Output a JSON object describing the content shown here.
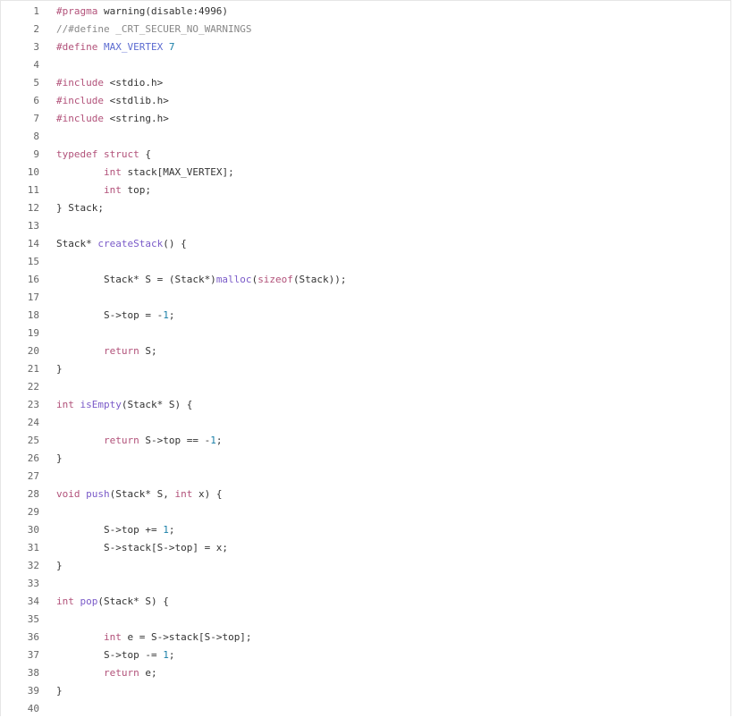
{
  "code_viewer": {
    "language": "c",
    "lines": [
      {
        "num": "1",
        "tokens": [
          {
            "t": "#pragma",
            "k": "pp"
          },
          {
            "t": " warning(disable:4996)",
            "k": "plain"
          }
        ]
      },
      {
        "num": "2",
        "tokens": [
          {
            "t": "//#define _CRT_SECUER_NO_WARNINGS",
            "k": "cm"
          }
        ]
      },
      {
        "num": "3",
        "tokens": [
          {
            "t": "#define",
            "k": "pp"
          },
          {
            "t": " ",
            "k": "plain"
          },
          {
            "t": "MAX_VERTEX",
            "k": "mac"
          },
          {
            "t": " ",
            "k": "plain"
          },
          {
            "t": "7",
            "k": "num"
          }
        ]
      },
      {
        "num": "4",
        "tokens": []
      },
      {
        "num": "5",
        "tokens": [
          {
            "t": "#include",
            "k": "pp"
          },
          {
            "t": " <stdio.h>",
            "k": "str"
          }
        ]
      },
      {
        "num": "6",
        "tokens": [
          {
            "t": "#include",
            "k": "pp"
          },
          {
            "t": " <stdlib.h>",
            "k": "str"
          }
        ]
      },
      {
        "num": "7",
        "tokens": [
          {
            "t": "#include",
            "k": "pp"
          },
          {
            "t": " <string.h>",
            "k": "str"
          }
        ]
      },
      {
        "num": "8",
        "tokens": []
      },
      {
        "num": "9",
        "tokens": [
          {
            "t": "typedef",
            "k": "kw"
          },
          {
            "t": " ",
            "k": "plain"
          },
          {
            "t": "struct",
            "k": "kw"
          },
          {
            "t": " {",
            "k": "plain"
          }
        ]
      },
      {
        "num": "10",
        "tokens": [
          {
            "t": "        ",
            "k": "plain"
          },
          {
            "t": "int",
            "k": "kw"
          },
          {
            "t": " stack[MAX_VERTEX];",
            "k": "plain"
          }
        ]
      },
      {
        "num": "11",
        "tokens": [
          {
            "t": "        ",
            "k": "plain"
          },
          {
            "t": "int",
            "k": "kw"
          },
          {
            "t": " top;",
            "k": "plain"
          }
        ]
      },
      {
        "num": "12",
        "tokens": [
          {
            "t": "} Stack;",
            "k": "plain"
          }
        ]
      },
      {
        "num": "13",
        "tokens": []
      },
      {
        "num": "14",
        "tokens": [
          {
            "t": "Stack* ",
            "k": "plain"
          },
          {
            "t": "createStack",
            "k": "fn"
          },
          {
            "t": "() {",
            "k": "plain"
          }
        ]
      },
      {
        "num": "15",
        "tokens": []
      },
      {
        "num": "16",
        "tokens": [
          {
            "t": "        Stack* S = (Stack*)",
            "k": "plain"
          },
          {
            "t": "malloc",
            "k": "fn"
          },
          {
            "t": "(",
            "k": "plain"
          },
          {
            "t": "sizeof",
            "k": "kw"
          },
          {
            "t": "(Stack));",
            "k": "plain"
          }
        ]
      },
      {
        "num": "17",
        "tokens": []
      },
      {
        "num": "18",
        "tokens": [
          {
            "t": "        S->top = -",
            "k": "plain"
          },
          {
            "t": "1",
            "k": "num"
          },
          {
            "t": ";",
            "k": "plain"
          }
        ]
      },
      {
        "num": "19",
        "tokens": []
      },
      {
        "num": "20",
        "tokens": [
          {
            "t": "        ",
            "k": "plain"
          },
          {
            "t": "return",
            "k": "kw"
          },
          {
            "t": " S;",
            "k": "plain"
          }
        ]
      },
      {
        "num": "21",
        "tokens": [
          {
            "t": "}",
            "k": "plain"
          }
        ]
      },
      {
        "num": "22",
        "tokens": []
      },
      {
        "num": "23",
        "tokens": [
          {
            "t": "int",
            "k": "kw"
          },
          {
            "t": " ",
            "k": "plain"
          },
          {
            "t": "isEmpty",
            "k": "fn"
          },
          {
            "t": "(Stack* S) {",
            "k": "plain"
          }
        ]
      },
      {
        "num": "24",
        "tokens": []
      },
      {
        "num": "25",
        "tokens": [
          {
            "t": "        ",
            "k": "plain"
          },
          {
            "t": "return",
            "k": "kw"
          },
          {
            "t": " S->top == -",
            "k": "plain"
          },
          {
            "t": "1",
            "k": "num"
          },
          {
            "t": ";",
            "k": "plain"
          }
        ]
      },
      {
        "num": "26",
        "tokens": [
          {
            "t": "}",
            "k": "plain"
          }
        ]
      },
      {
        "num": "27",
        "tokens": []
      },
      {
        "num": "28",
        "tokens": [
          {
            "t": "void",
            "k": "kw"
          },
          {
            "t": " ",
            "k": "plain"
          },
          {
            "t": "push",
            "k": "fn"
          },
          {
            "t": "(Stack* S, ",
            "k": "plain"
          },
          {
            "t": "int",
            "k": "kw"
          },
          {
            "t": " x) {",
            "k": "plain"
          }
        ]
      },
      {
        "num": "29",
        "tokens": []
      },
      {
        "num": "30",
        "tokens": [
          {
            "t": "        S->top += ",
            "k": "plain"
          },
          {
            "t": "1",
            "k": "num"
          },
          {
            "t": ";",
            "k": "plain"
          }
        ]
      },
      {
        "num": "31",
        "tokens": [
          {
            "t": "        S->stack[S->top] = x;",
            "k": "plain"
          }
        ]
      },
      {
        "num": "32",
        "tokens": [
          {
            "t": "}",
            "k": "plain"
          }
        ]
      },
      {
        "num": "33",
        "tokens": []
      },
      {
        "num": "34",
        "tokens": [
          {
            "t": "int",
            "k": "kw"
          },
          {
            "t": " ",
            "k": "plain"
          },
          {
            "t": "pop",
            "k": "fn"
          },
          {
            "t": "(Stack* S) {",
            "k": "plain"
          }
        ]
      },
      {
        "num": "35",
        "tokens": []
      },
      {
        "num": "36",
        "tokens": [
          {
            "t": "        ",
            "k": "plain"
          },
          {
            "t": "int",
            "k": "kw"
          },
          {
            "t": " e = S->stack[S->top];",
            "k": "plain"
          }
        ]
      },
      {
        "num": "37",
        "tokens": [
          {
            "t": "        S->top -= ",
            "k": "plain"
          },
          {
            "t": "1",
            "k": "num"
          },
          {
            "t": ";",
            "k": "plain"
          }
        ]
      },
      {
        "num": "38",
        "tokens": [
          {
            "t": "        ",
            "k": "plain"
          },
          {
            "t": "return",
            "k": "kw"
          },
          {
            "t": " e;",
            "k": "plain"
          }
        ]
      },
      {
        "num": "39",
        "tokens": [
          {
            "t": "}",
            "k": "plain"
          }
        ]
      },
      {
        "num": "40",
        "tokens": []
      }
    ]
  },
  "colors": {
    "keyword": "#b2527a",
    "macro": "#5a6ad0",
    "function": "#7a5ac8",
    "number": "#1a7fa8",
    "comment": "#888888",
    "text": "#333333",
    "line_number": "#666666",
    "background": "#ffffff",
    "border": "#e6e6e6"
  }
}
